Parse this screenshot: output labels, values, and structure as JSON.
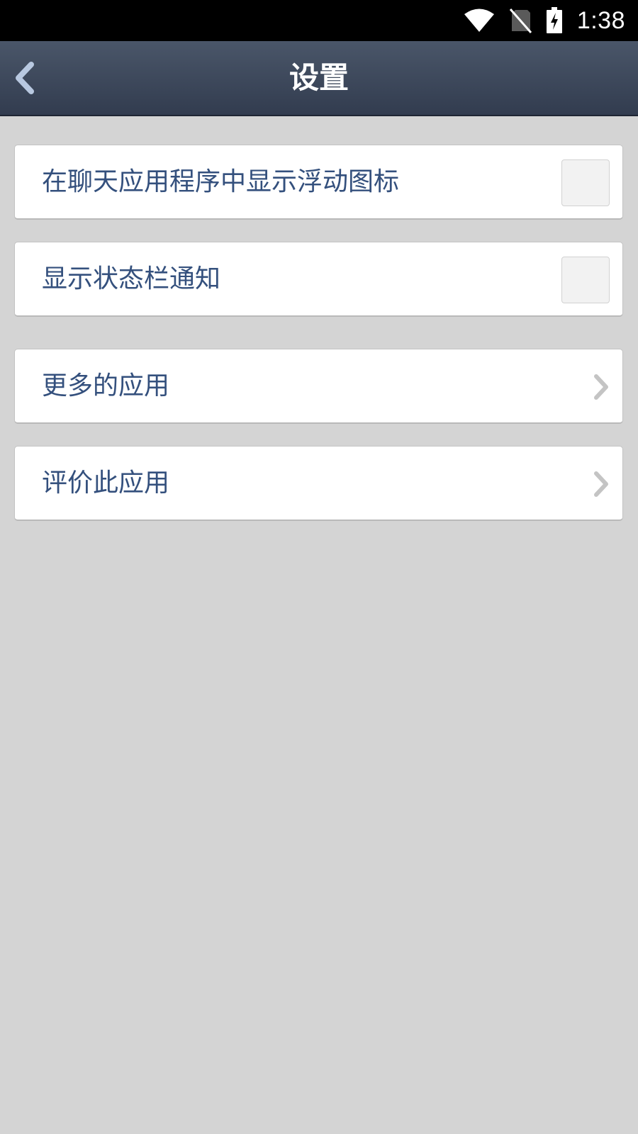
{
  "status_bar": {
    "time": "1:38",
    "icons": [
      "wifi-icon",
      "no-sim-icon",
      "battery-charging-icon"
    ]
  },
  "header": {
    "title": "设置",
    "back_icon": "chevron-left-icon"
  },
  "settings": {
    "items": [
      {
        "label": "在聊天应用程序中显示浮动图标",
        "type": "checkbox",
        "checked": false
      },
      {
        "label": "显示状态栏通知",
        "type": "checkbox",
        "checked": false
      },
      {
        "label": "更多的应用",
        "type": "link",
        "icon": "chevron-right-icon"
      },
      {
        "label": "评价此应用",
        "type": "link",
        "icon": "chevron-right-icon"
      }
    ]
  },
  "colors": {
    "status_bar": "#000000",
    "title_bar": "#3b4557",
    "background": "#d4d4d4",
    "card": "#ffffff",
    "label_text": "#34507d"
  }
}
